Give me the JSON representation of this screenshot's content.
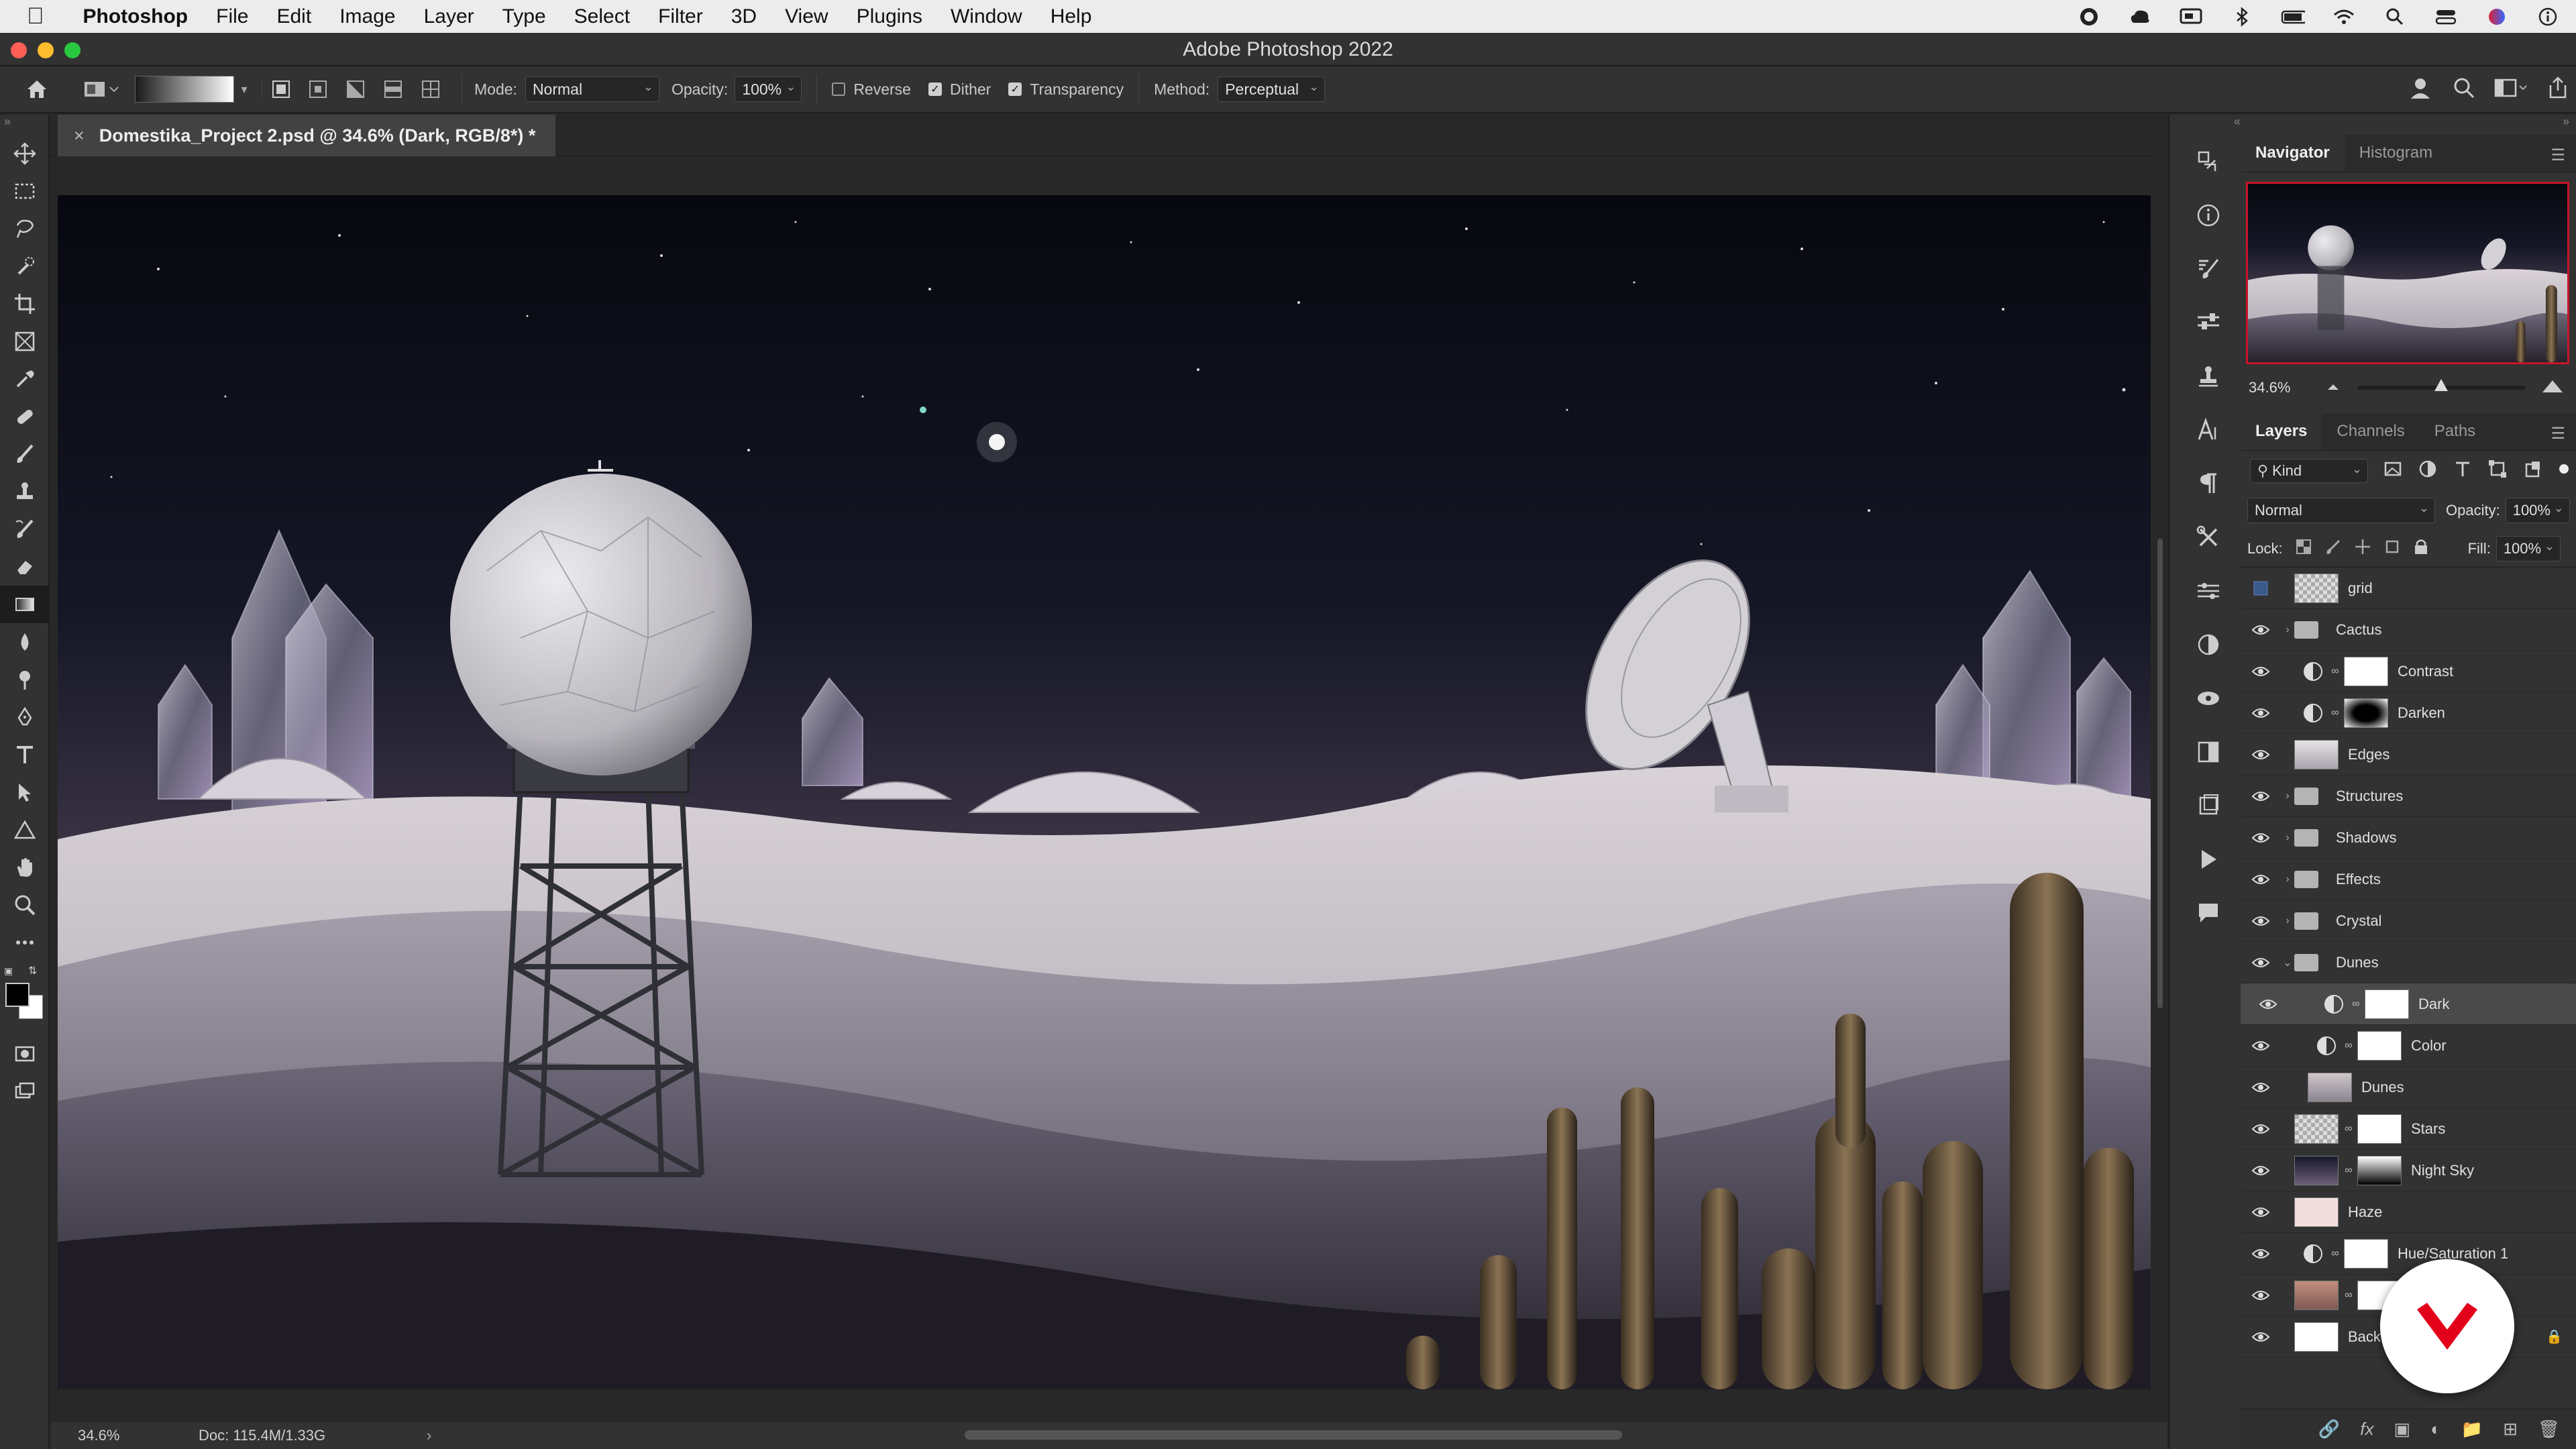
{
  "menubar": {
    "app": "Photoshop",
    "items": [
      "File",
      "Edit",
      "Image",
      "Layer",
      "Type",
      "Select",
      "Filter",
      "3D",
      "View",
      "Plugins",
      "Window",
      "Help"
    ]
  },
  "window": {
    "title": "Adobe Photoshop 2022"
  },
  "options": {
    "mode_label": "Mode:",
    "mode_value": "Normal",
    "opacity_label": "Opacity:",
    "opacity_value": "100%",
    "reverse_label": "Reverse",
    "reverse_checked": false,
    "dither_label": "Dither",
    "dither_checked": true,
    "transparency_label": "Transparency",
    "transparency_checked": true,
    "method_label": "Method:",
    "method_value": "Perceptual"
  },
  "document": {
    "tab_title": "Domestika_Project 2.psd @ 34.6% (Dark, RGB/8*) *"
  },
  "status": {
    "zoom": "34.6%",
    "doc": "Doc: 115.4M/1.33G"
  },
  "navigator": {
    "tabs": [
      "Navigator",
      "Histogram"
    ],
    "zoom": "34.6%",
    "zoom_fraction": 0.5
  },
  "layers_panel": {
    "tabs": [
      "Layers",
      "Channels",
      "Paths"
    ],
    "filter_label": "Kind",
    "blend_mode": "Normal",
    "opacity_label": "Opacity:",
    "opacity_value": "100%",
    "lock_label": "Lock:",
    "fill_label": "Fill:",
    "fill_value": "100%",
    "layers": [
      {
        "name": "grid",
        "kind": "pixel",
        "visible": false,
        "indent": 0
      },
      {
        "name": "Cactus",
        "kind": "group",
        "visible": true,
        "indent": 0,
        "open": false
      },
      {
        "name": "Contrast",
        "kind": "adjustment",
        "visible": true,
        "indent": 0
      },
      {
        "name": "Darken",
        "kind": "adjustment",
        "visible": true,
        "indent": 0
      },
      {
        "name": "Edges",
        "kind": "pixel",
        "visible": true,
        "indent": 0
      },
      {
        "name": "Structures",
        "kind": "group",
        "visible": true,
        "indent": 0,
        "open": false
      },
      {
        "name": "Shadows",
        "kind": "group",
        "visible": true,
        "indent": 0,
        "open": false
      },
      {
        "name": "Effects",
        "kind": "group",
        "visible": true,
        "indent": 0,
        "open": false
      },
      {
        "name": "Crystal",
        "kind": "group",
        "visible": true,
        "indent": 0,
        "open": false
      },
      {
        "name": "Dunes",
        "kind": "group",
        "visible": true,
        "indent": 0,
        "open": true
      },
      {
        "name": "Dark",
        "kind": "adjustment",
        "visible": true,
        "indent": 1,
        "selected": true
      },
      {
        "name": "Color",
        "kind": "adjustment",
        "visible": true,
        "indent": 1
      },
      {
        "name": "Dunes",
        "kind": "pixel",
        "visible": true,
        "indent": 1
      },
      {
        "name": "Stars",
        "kind": "pixel",
        "visible": true,
        "indent": 0
      },
      {
        "name": "Night Sky",
        "kind": "pixel",
        "visible": true,
        "indent": 0
      },
      {
        "name": "Haze",
        "kind": "pixel",
        "visible": true,
        "indent": 0
      },
      {
        "name": "Hue/Saturation 1",
        "kind": "adjustment",
        "visible": true,
        "indent": 0
      },
      {
        "name": "",
        "kind": "pixel",
        "visible": true,
        "indent": 0
      },
      {
        "name": "Back",
        "kind": "pixel",
        "visible": true,
        "indent": 0
      }
    ]
  },
  "colors": {
    "accent": "#4b8bf4",
    "nav_frame": "#c8142a",
    "brand": "#e3001b"
  }
}
